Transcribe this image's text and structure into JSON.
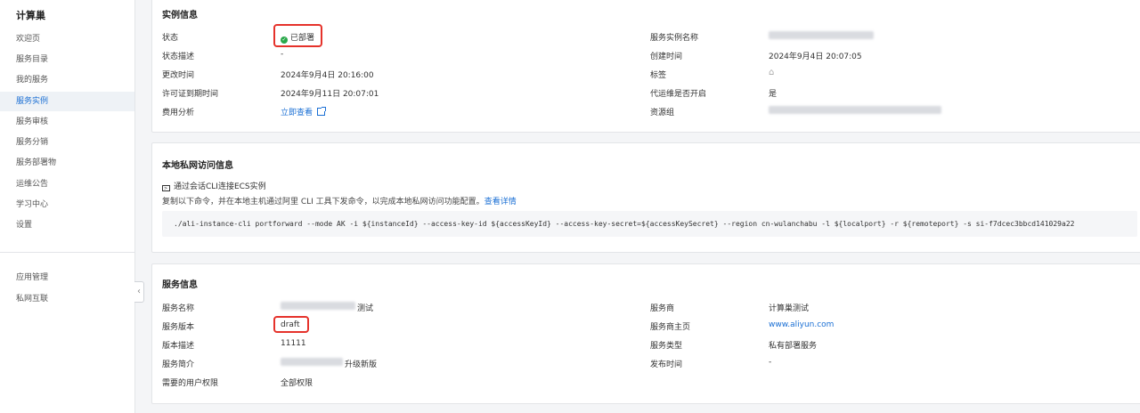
{
  "sidebar": {
    "title": "计算巢",
    "items": [
      "欢迎页",
      "服务目录",
      "我的服务",
      "服务实例",
      "服务审核",
      "服务分销",
      "服务部署物",
      "运维公告",
      "学习中心",
      "设置"
    ],
    "items2": [
      "应用管理",
      "私网互联"
    ],
    "collapse_icon": "‹"
  },
  "instance": {
    "title": "实例信息",
    "status_label": "状态",
    "status_value": "已部署",
    "status_desc_label": "状态描述",
    "status_desc_value": "-",
    "update_time_label": "更改时间",
    "update_time_value": "2024年9月4日 20:16:00",
    "license_label": "许可证到期时间",
    "license_value": "2024年9月11日 20:07:01",
    "cost_label": "费用分析",
    "cost_value": "立即查看",
    "name_label": "服务实例名称",
    "create_label": "创建时间",
    "create_value": "2024年9月4日 20:07:05",
    "tag_label": "标签",
    "ops_label": "代运维是否开启",
    "ops_value": "是",
    "rg_label": "资源组"
  },
  "private": {
    "title": "本地私网访问信息",
    "subtitle": "通过会话CLI连接ECS实例",
    "desc": "复制以下命令，并在本地主机通过阿里 CLI 工具下发命令，以完成本地私网访问功能配置。",
    "desc_link": "查看详情",
    "cmd": "./ali-instance-cli portforward --mode AK -i ${instanceId} --access-key-id ${accessKeyId} --access-key-secret=${accessKeySecret} --region cn-wulanchabu -l ${localport} -r ${remoteport} -s si-f7dcec3bbcd141029a22"
  },
  "service": {
    "title": "服务信息",
    "name_label": "服务名称",
    "name_value_tail": "测试",
    "version_label": "服务版本",
    "version_value": "draft",
    "vdesc_label": "版本描述",
    "vdesc_value": "11111",
    "intro_label": "服务简介",
    "intro_value_tail": "升级新版",
    "perm_label": "需要的用户权限",
    "perm_value": "全部权限",
    "provider_label": "服务商",
    "provider_value": "计算巢测试",
    "homepage_label": "服务商主页",
    "homepage_value": "www.aliyun.com",
    "type_label": "服务类型",
    "type_value": "私有部署服务",
    "publish_label": "发布时间",
    "publish_value": "-"
  },
  "colors": {
    "accent": "#1a6fd4",
    "highlight": "#e5322b",
    "success": "#2aa84a"
  },
  "icons": [
    "check-circle-icon",
    "external-link-icon",
    "tag-icon",
    "terminal-icon",
    "chevron-left-icon"
  ]
}
